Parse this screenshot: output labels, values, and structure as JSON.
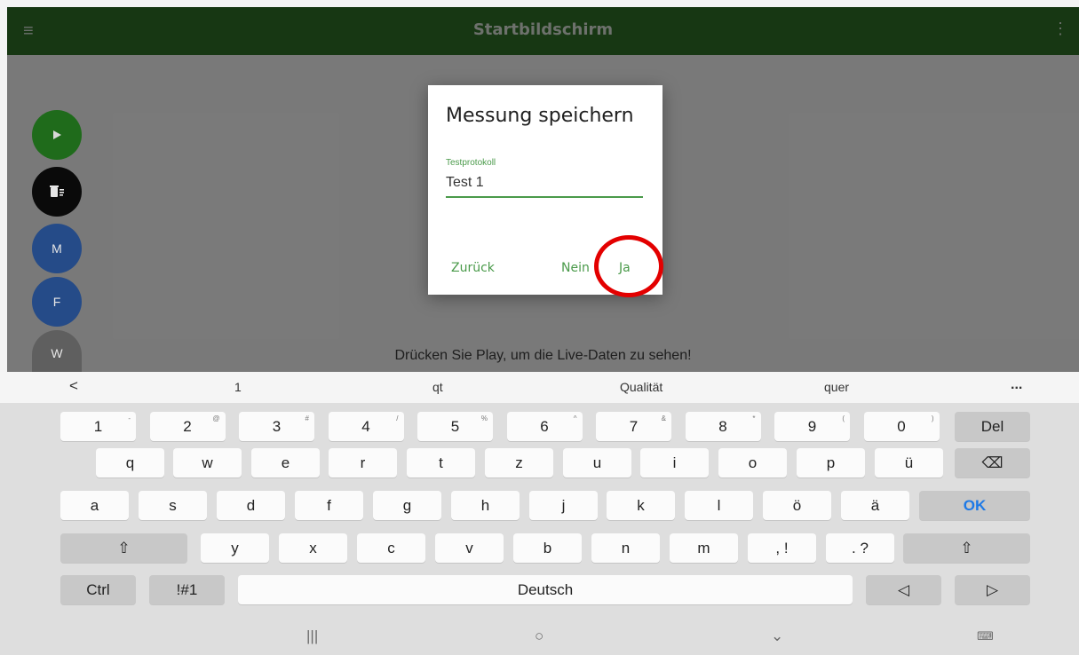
{
  "appbar": {
    "title": "Startbildschirm",
    "menu_icon": "menu-icon",
    "overflow_icon": "kebab-icon"
  },
  "fabs": {
    "play_icon": "play-icon",
    "delete_icon": "trash-icon",
    "m_label": "M",
    "f_label": "F",
    "w_label": "W"
  },
  "main": {
    "hint": "Drücken Sie Play, um die Live-Daten zu sehen!"
  },
  "dialog": {
    "title": "Messung speichern",
    "field_label": "Testprotokoll",
    "field_value": "Test 1",
    "back_label": "Zurück",
    "no_label": "Nein",
    "yes_label": "Ja"
  },
  "suggestions": {
    "back": "<",
    "items": [
      "1",
      "qt",
      "Qualität",
      "quer"
    ],
    "more": "..."
  },
  "keyboard": {
    "row1": [
      {
        "k": "1",
        "s": "-"
      },
      {
        "k": "2",
        "s": "@"
      },
      {
        "k": "3",
        "s": "#"
      },
      {
        "k": "4",
        "s": "/"
      },
      {
        "k": "5",
        "s": "%"
      },
      {
        "k": "6",
        "s": "^"
      },
      {
        "k": "7",
        "s": "&"
      },
      {
        "k": "8",
        "s": "*"
      },
      {
        "k": "9",
        "s": "("
      },
      {
        "k": "0",
        "s": ")"
      }
    ],
    "del": "Del",
    "row2": [
      "q",
      "w",
      "e",
      "r",
      "t",
      "z",
      "u",
      "i",
      "o",
      "p",
      "ü"
    ],
    "backspace_icon": "⌫",
    "row3": [
      "a",
      "s",
      "d",
      "f",
      "g",
      "h",
      "j",
      "k",
      "l",
      "ö",
      "ä"
    ],
    "ok": "OK",
    "shift_icon": "⇧",
    "row4": [
      "y",
      "x",
      "c",
      "v",
      "b",
      "n",
      "m"
    ],
    "comma": ", !",
    "period": ". ?",
    "ctrl": "Ctrl",
    "sym": "!#1",
    "space": "Deutsch",
    "left_arrow": "◁",
    "right_arrow": "▷"
  },
  "navbar": {
    "recents": "|||",
    "home": "○",
    "back": "⌄",
    "keyboard": "⌨"
  }
}
